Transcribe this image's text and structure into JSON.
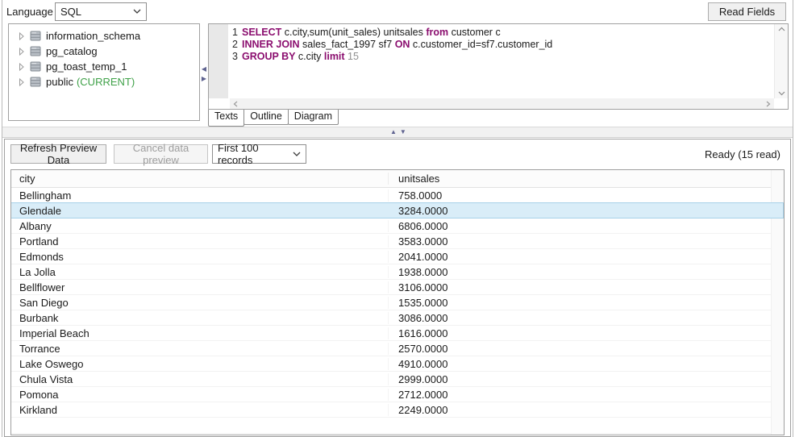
{
  "top": {
    "language_label": "Language",
    "language_value": "SQL",
    "read_fields_label": "Read Fields"
  },
  "tree": {
    "items": [
      {
        "label": "information_schema",
        "suffix": ""
      },
      {
        "label": "pg_catalog",
        "suffix": ""
      },
      {
        "label": "pg_toast_temp_1",
        "suffix": ""
      },
      {
        "label": "public",
        "suffix": "(CURRENT)"
      }
    ]
  },
  "editor": {
    "lines": [
      {
        "n": "1",
        "s": [
          {
            "t": "SELECT"
          },
          {
            "t": " c.city,sum(unit_sales) unitsales "
          },
          {
            "t": "from"
          },
          {
            "t": " customer c"
          }
        ]
      },
      {
        "n": "2",
        "s": [
          {
            "t": "INNER JOIN"
          },
          {
            "t": " sales_fact_1997 sf7 "
          },
          {
            "t": "ON"
          },
          {
            "t": " c.customer_id=sf7.customer_id"
          }
        ]
      },
      {
        "n": "3",
        "s": [
          {
            "t": "GROUP BY"
          },
          {
            "t": " c.city "
          },
          {
            "t": "limit"
          },
          {
            "t": " 15"
          }
        ]
      }
    ],
    "tabs": [
      "Texts",
      "Outline",
      "Diagram"
    ],
    "active_tab": "Texts"
  },
  "preview": {
    "refresh_label": "Refresh Preview Data",
    "cancel_label": "Cancel data preview",
    "records_limit_value": "First 100 records",
    "status": "Ready (15 read)"
  },
  "table": {
    "columns": [
      "city",
      "unitsales"
    ],
    "selected_city": "Glendale",
    "rows": [
      [
        "Bellingham",
        "758.0000"
      ],
      [
        "Glendale",
        "3284.0000"
      ],
      [
        "Albany",
        "6806.0000"
      ],
      [
        "Portland",
        "3583.0000"
      ],
      [
        "Edmonds",
        "2041.0000"
      ],
      [
        "La Jolla",
        "1938.0000"
      ],
      [
        "Bellflower",
        "3106.0000"
      ],
      [
        "San Diego",
        "1535.0000"
      ],
      [
        "Burbank",
        "3086.0000"
      ],
      [
        "Imperial Beach",
        "1616.0000"
      ],
      [
        "Torrance",
        "2570.0000"
      ],
      [
        "Lake Oswego",
        "4910.0000"
      ],
      [
        "Chula Vista",
        "2999.0000"
      ],
      [
        "Pomona",
        "2712.0000"
      ],
      [
        "Kirkland",
        "2249.0000"
      ]
    ]
  },
  "colors": {
    "keyword": "#8b0e6f",
    "current_schema_green": "#3fa148",
    "selected_row_bg": "#d9edf8",
    "selected_row_border": "#a7d1e8",
    "splitter_arrow": "#5f6390"
  }
}
